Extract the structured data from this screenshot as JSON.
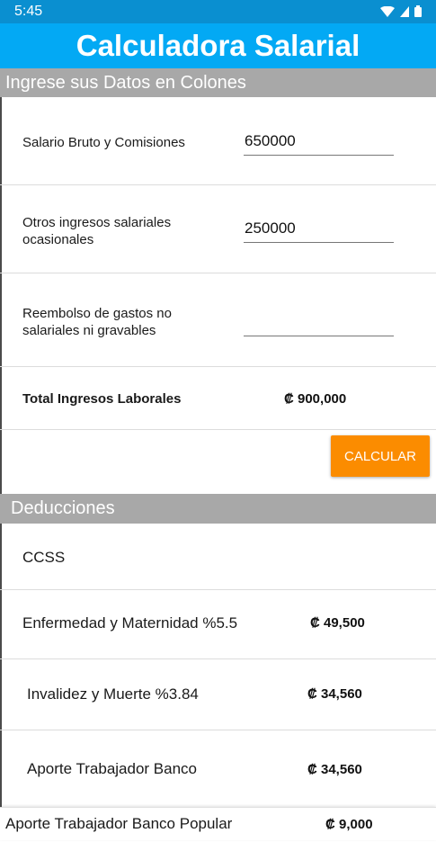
{
  "status_bar": {
    "time": "5:45"
  },
  "app": {
    "title": "Calculadora Salarial"
  },
  "ingresos": {
    "header": "Ingrese sus Datos en Colones",
    "rows": [
      {
        "label": "Salario Bruto y Comisiones",
        "value": "650000"
      },
      {
        "label": "Otros ingresos salariales ocasionales",
        "value": "250000"
      },
      {
        "label": "Reembolso de gastos no salariales ni gravables",
        "value": ""
      }
    ],
    "total_label": "Total Ingresos Laborales",
    "total_value": "₡ 900,000"
  },
  "buttons": {
    "calcular": "CALCULAR"
  },
  "deducciones": {
    "header": "Deducciones",
    "ccss_label": "CCSS",
    "items": [
      {
        "label": "Enfermedad y Maternidad %5.5",
        "value": "₡ 49,500"
      },
      {
        "label": "Invalidez y Muerte %3.84",
        "value": "₡ 34,560"
      },
      {
        "label": "Aporte Trabajador Banco",
        "value": "₡ 34,560"
      },
      {
        "label": "Aporte Trabajador Banco Popular",
        "value": "₡ 9,000"
      }
    ]
  },
  "colors": {
    "status_bar": "#0a8fd0",
    "title_bar": "#03a9f4",
    "section_header": "#a8a8a8",
    "button": "#fb8c00"
  }
}
